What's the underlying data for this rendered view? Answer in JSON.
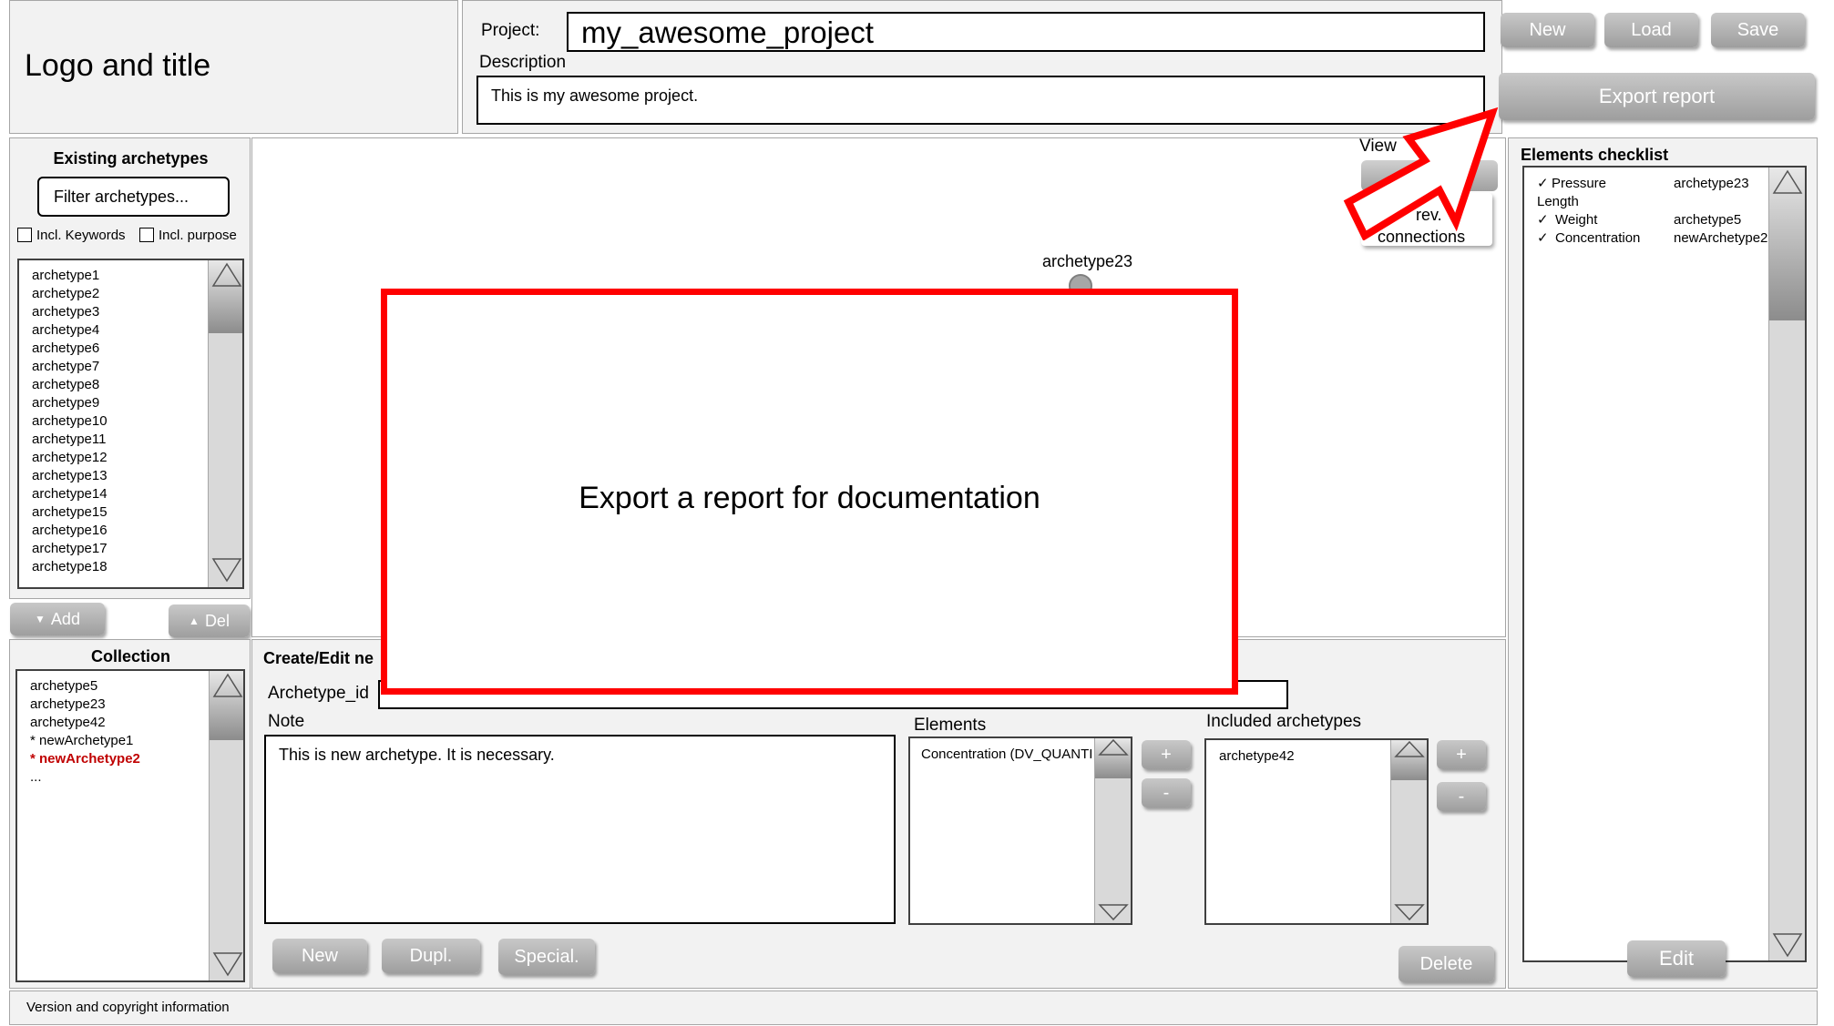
{
  "header": {
    "logo_title": "Logo and title",
    "project_label": "Project:",
    "project_value": "my_awesome_project",
    "description_label": "Description",
    "description_value": "This is my awesome project.",
    "buttons": {
      "new": "New",
      "load": "Load",
      "save": "Save",
      "export": "Export report"
    }
  },
  "archetypes_panel": {
    "title": "Existing archetypes",
    "filter_placeholder": "Filter archetypes...",
    "incl_keywords": "Incl. Keywords",
    "incl_purpose": "Incl. purpose",
    "items": [
      "archetype1",
      "archetype2",
      "archetype3",
      "archetype4",
      "archetype6",
      "archetype7",
      "archetype8",
      "archetype9",
      "archetype10",
      "archetype11",
      "archetype12",
      "archetype13",
      "archetype14",
      "archetype15",
      "archetype16",
      "archetype17",
      "archetype18"
    ],
    "add": "Add",
    "del": "Del"
  },
  "canvas": {
    "view_label": "View",
    "connections_partial_1": "rev.",
    "connections_partial_2": "connections",
    "node_label": "archetype23",
    "callout_text": "Export a report for documentation"
  },
  "collection": {
    "title": "Collection",
    "items": [
      "archetype5",
      "archetype23",
      "archetype42",
      "* newArchetype1",
      "* newArchetype2",
      "..."
    ],
    "highlight_color": "#c00000"
  },
  "editor": {
    "title_partial": "Create/Edit ne",
    "archetype_id_label": "Archetype_id",
    "note_label": "Note",
    "note_value": "This is new archetype. It is necessary.",
    "elements_label": "Elements",
    "elements_items": [
      "Concentration (DV_QUANTI"
    ],
    "included_label": "Included archetypes",
    "included_items": [
      "archetype42"
    ],
    "plus": "+",
    "minus": "-",
    "buttons": {
      "new": "New",
      "dupl": "Dupl.",
      "special": "Special.",
      "delete": "Delete"
    }
  },
  "checklist": {
    "title": "Elements checklist",
    "rows": [
      {
        "check": "✓",
        "name": "Pressure",
        "archetype": "archetype23"
      },
      {
        "check": "",
        "name": "Length",
        "archetype": ""
      },
      {
        "check": "✓",
        "name": "Weight",
        "archetype": "archetype5"
      },
      {
        "check": "✓",
        "name": "Concentration",
        "archetype": "newArchetype2"
      }
    ],
    "edit": "Edit"
  },
  "footer": {
    "text": "Version and copyright information"
  },
  "colors": {
    "callout": "#ff0000",
    "panel_bg": "#f2f2f2",
    "button_gray": "#a6a6a6"
  }
}
